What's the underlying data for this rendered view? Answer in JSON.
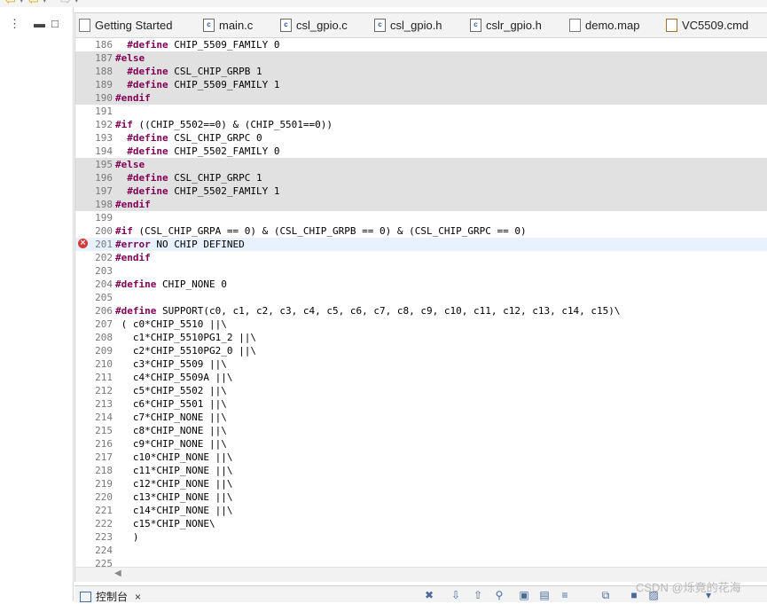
{
  "toolbar": {
    "icons": [
      "arrow-left-yellow-icon",
      "dropdown-icon",
      "arrow-back-yellow-icon",
      "dropdown-icon",
      "arrow-forward-gray-icon",
      "dropdown-icon"
    ]
  },
  "left_panel": {
    "icons": [
      "view-menu-icon",
      "minimize-icon",
      "maximize-icon"
    ]
  },
  "tabs": [
    {
      "label": "Getting Started",
      "icon": "document-icon"
    },
    {
      "label": "main.c",
      "icon": "c-file-icon"
    },
    {
      "label": "csl_gpio.c",
      "icon": "c-file-icon"
    },
    {
      "label": "csl_gpio.h",
      "icon": "c-file-icon"
    },
    {
      "label": "cslr_gpio.h",
      "icon": "c-file-icon"
    },
    {
      "label": "demo.map",
      "icon": "document-icon"
    },
    {
      "label": "VC5509.cmd",
      "icon": "cmd-file-icon"
    }
  ],
  "code_lines": [
    {
      "num": "186",
      "text": "  #define CHIP_5509_FAMILY 0"
    },
    {
      "num": "187",
      "text": "#else"
    },
    {
      "num": "188",
      "text": "  #define CSL_CHIP_GRPB 1"
    },
    {
      "num": "189",
      "text": "  #define CHIP_5509_FAMILY 1"
    },
    {
      "num": "190",
      "text": "#endif"
    },
    {
      "num": "191",
      "text": ""
    },
    {
      "num": "192",
      "text": "#if ((CHIP_5502==0) & (CHIP_5501==0))"
    },
    {
      "num": "193",
      "text": "  #define CSL_CHIP_GRPC 0"
    },
    {
      "num": "194",
      "text": "  #define CHIP_5502_FAMILY 0"
    },
    {
      "num": "195",
      "text": "#else"
    },
    {
      "num": "196",
      "text": "  #define CSL_CHIP_GRPC 1"
    },
    {
      "num": "197",
      "text": "  #define CHIP_5502_FAMILY 1"
    },
    {
      "num": "198",
      "text": "#endif"
    },
    {
      "num": "199",
      "text": ""
    },
    {
      "num": "200",
      "text": "#if (CSL_CHIP_GRPA == 0) & (CSL_CHIP_GRPB == 0) & (CSL_CHIP_GRPC == 0)"
    },
    {
      "num": "201",
      "text": "#error NO CHIP DEFINED"
    },
    {
      "num": "202",
      "text": "#endif"
    },
    {
      "num": "203",
      "text": ""
    },
    {
      "num": "204",
      "text": "#define CHIP_NONE 0"
    },
    {
      "num": "205",
      "text": ""
    },
    {
      "num": "206",
      "text": "#define SUPPORT(c0, c1, c2, c3, c4, c5, c6, c7, c8, c9, c10, c11, c12, c13, c14, c15)\\"
    },
    {
      "num": "207",
      "text": " ( c0*CHIP_5510 ||\\"
    },
    {
      "num": "208",
      "text": "   c1*CHIP_5510PG1_2 ||\\"
    },
    {
      "num": "209",
      "text": "   c2*CHIP_5510PG2_0 ||\\"
    },
    {
      "num": "210",
      "text": "   c3*CHIP_5509 ||\\"
    },
    {
      "num": "211",
      "text": "   c4*CHIP_5509A ||\\"
    },
    {
      "num": "212",
      "text": "   c5*CHIP_5502 ||\\"
    },
    {
      "num": "213",
      "text": "   c6*CHIP_5501 ||\\"
    },
    {
      "num": "214",
      "text": "   c7*CHIP_NONE ||\\"
    },
    {
      "num": "215",
      "text": "   c8*CHIP_NONE ||\\"
    },
    {
      "num": "216",
      "text": "   c9*CHIP_NONE ||\\"
    },
    {
      "num": "217",
      "text": "   c10*CHIP_NONE ||\\"
    },
    {
      "num": "218",
      "text": "   c11*CHIP_NONE ||\\"
    },
    {
      "num": "219",
      "text": "   c12*CHIP_NONE ||\\"
    },
    {
      "num": "220",
      "text": "   c13*CHIP_NONE ||\\"
    },
    {
      "num": "221",
      "text": "   c14*CHIP_NONE ||\\"
    },
    {
      "num": "222",
      "text": "   c15*CHIP_NONE\\"
    },
    {
      "num": "223",
      "text": "   )"
    },
    {
      "num": "224",
      "text": ""
    },
    {
      "num": "225",
      "text": ""
    }
  ],
  "inactive_lines": [
    "187",
    "188",
    "189",
    "190",
    "195",
    "196",
    "197",
    "198"
  ],
  "error_line": "201",
  "console": {
    "tab_label": "控制台",
    "close_label": "×",
    "buttons": [
      "remove-icon",
      "scroll-down-icon",
      "scroll-up-icon",
      "pin-icon",
      "display-selected-icon",
      "new-console-icon",
      "word-wrap-icon",
      "open-console-icon",
      "terminate-icon",
      "debug-icon",
      "menu-icon"
    ]
  },
  "watermark": "CSDN @烁竟的花海",
  "colors": {
    "keyword": "#7f0055",
    "inactive_bg": "#e1e1e1",
    "current_line_bg": "#e8f2fe",
    "error_marker": "#d63a3a"
  }
}
